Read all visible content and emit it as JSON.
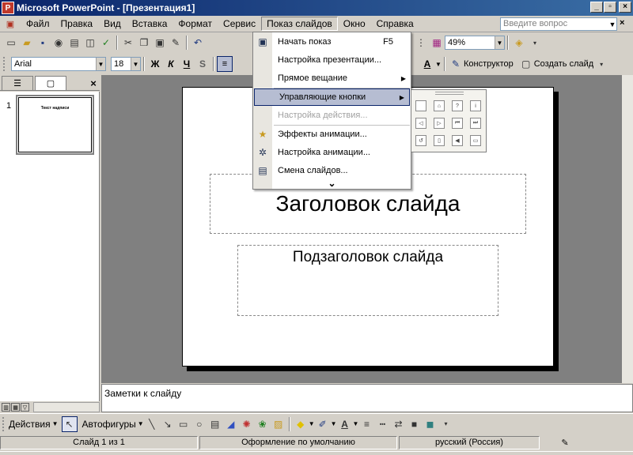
{
  "window": {
    "title": "Microsoft PowerPoint - [Презентация1]",
    "icon": "powerpoint-icon",
    "minimize": "_",
    "maximize": "▫",
    "close": "×"
  },
  "menubar": {
    "items": [
      "Файл",
      "Правка",
      "Вид",
      "Вставка",
      "Формат",
      "Сервис",
      "Показ слайдов",
      "Окно",
      "Справка"
    ],
    "help_placeholder": "Введите вопрос",
    "doc_controls": {
      "minimize": "_",
      "restore": "▫",
      "close": "×"
    }
  },
  "standard_toolbar": {
    "zoom": "49%"
  },
  "format_toolbar": {
    "font": "Arial",
    "size": "18",
    "bold": "Ж",
    "italic": "К",
    "underline": "Ч",
    "shadow": "S",
    "designer": "Конструктор",
    "new_slide": "Создать слайд"
  },
  "slideshow_menu": {
    "items": [
      {
        "label": "Начать показ",
        "shortcut": "F5",
        "icon": "slideshow-icon",
        "state": "normal"
      },
      {
        "label": "Настройка презентации...",
        "shortcut": "",
        "icon": "",
        "state": "normal"
      },
      {
        "label": "Прямое вещание",
        "shortcut": "",
        "icon": "",
        "state": "submenu"
      },
      {
        "label": "Управляющие кнопки",
        "shortcut": "",
        "icon": "",
        "state": "highlighted"
      },
      {
        "label": "Настройка действия...",
        "shortcut": "",
        "icon": "",
        "state": "disabled"
      },
      {
        "label": "Эффекты анимации...",
        "shortcut": "",
        "icon": "animation-effects-icon",
        "state": "normal"
      },
      {
        "label": "Настройка анимации...",
        "shortcut": "",
        "icon": "custom-animation-icon",
        "state": "normal"
      },
      {
        "label": "Смена слайдов...",
        "shortcut": "",
        "icon": "slide-transition-icon",
        "state": "normal"
      }
    ],
    "expand": "⌄"
  },
  "action_buttons": [
    "custom",
    "home",
    "help",
    "info",
    "back",
    "forward",
    "beginning",
    "end",
    "return",
    "document",
    "sound",
    "movie"
  ],
  "tabs": {
    "outline": "☰",
    "slides": "▢",
    "close": "×"
  },
  "thumbnail": {
    "number": "1",
    "title": "Текст надписи"
  },
  "slide": {
    "title": "Заголовок слайда",
    "subtitle": "Подзаголовок слайда"
  },
  "notes": {
    "placeholder": "Заметки к слайду"
  },
  "drawing_toolbar": {
    "actions": "Действия",
    "autoshapes": "Автофигуры"
  },
  "status": {
    "slide": "Слайд 1 из 1",
    "design": "Оформление по умолчанию",
    "language": "русский (Россия)"
  }
}
